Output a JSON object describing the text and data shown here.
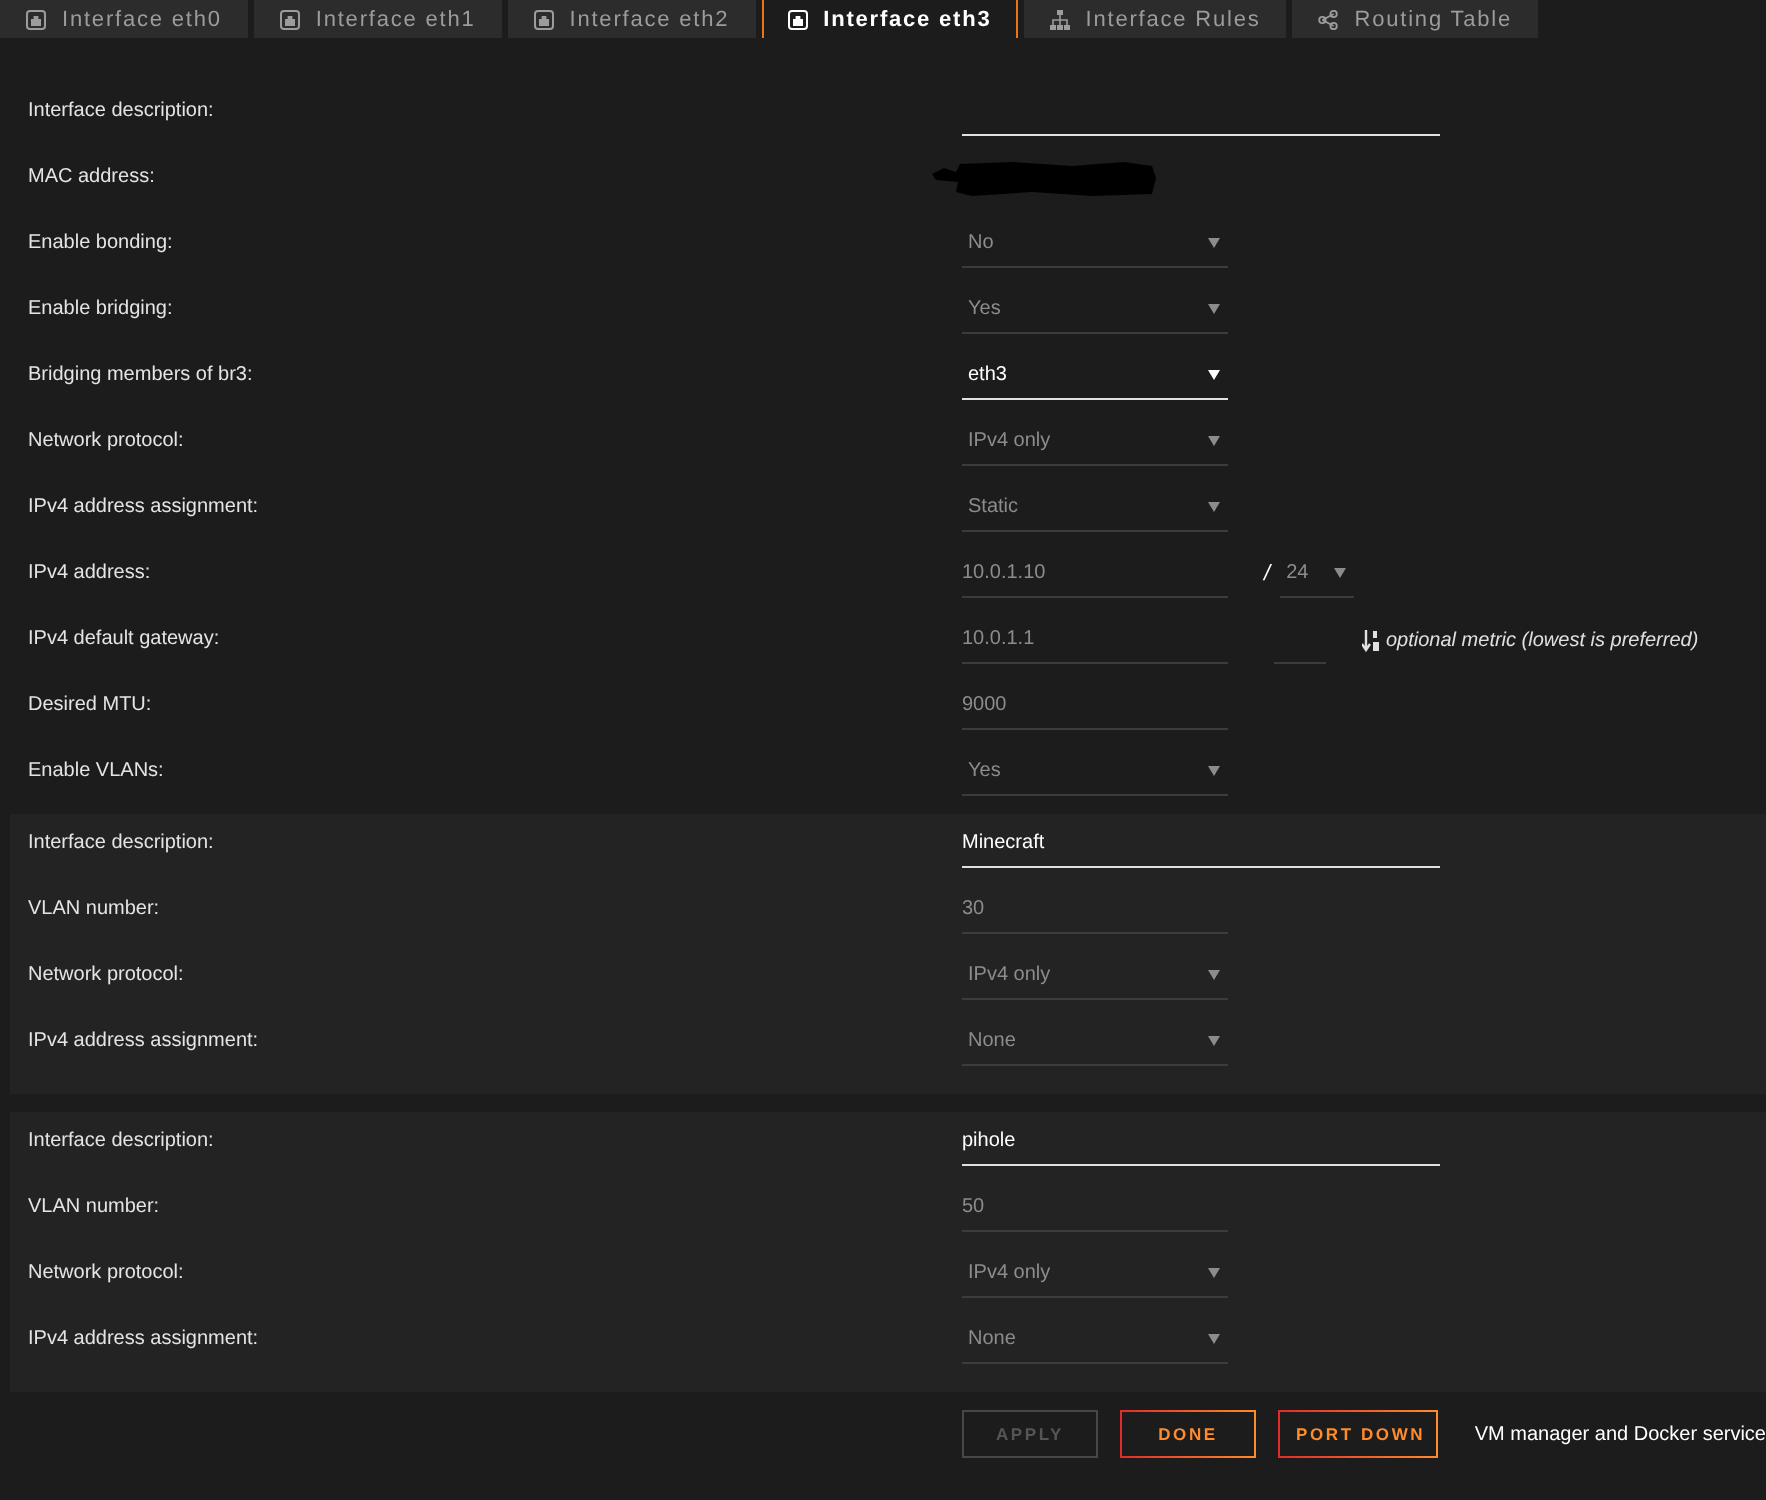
{
  "tabs": [
    {
      "label": "Interface eth0",
      "kind": "interface",
      "selected": false
    },
    {
      "label": "Interface eth1",
      "kind": "interface",
      "selected": false
    },
    {
      "label": "Interface eth2",
      "kind": "interface",
      "selected": false
    },
    {
      "label": "Interface eth3",
      "kind": "interface",
      "selected": true
    },
    {
      "label": "Interface Rules",
      "kind": "rules",
      "selected": false
    },
    {
      "label": "Routing Table",
      "kind": "routing",
      "selected": false
    }
  ],
  "interface": {
    "rows": [
      {
        "label": "Interface description:",
        "kind": "line",
        "disabled": false
      },
      {
        "label": "MAC address:",
        "kind": "redacted"
      },
      {
        "label": "Enable bonding:",
        "kind": "select",
        "value": "No",
        "disabled": true
      },
      {
        "label": "Enable bridging:",
        "kind": "select",
        "value": "Yes",
        "disabled": true
      },
      {
        "label": "Bridging members of br3:",
        "kind": "select",
        "value": "eth3",
        "disabled": false
      },
      {
        "label": "Network protocol:",
        "kind": "select",
        "value": "IPv4 only",
        "disabled": true
      },
      {
        "label": "IPv4 address assignment:",
        "kind": "select",
        "value": "Static",
        "disabled": true
      },
      {
        "label": "IPv4 address:",
        "kind": "address",
        "value": "10.0.1.10",
        "disabled": true,
        "separator": "/",
        "prefix": {
          "value": "24",
          "disabled": true
        }
      },
      {
        "label": "IPv4 default gateway:",
        "kind": "gateway",
        "value": "10.0.1.1",
        "disabled": true,
        "metric": {
          "disabled": true
        },
        "hint": "optional metric (lowest is preferred)"
      },
      {
        "label": "Desired MTU:",
        "kind": "number",
        "value": "9000",
        "disabled": true
      },
      {
        "label": "Enable VLANs:",
        "kind": "select",
        "value": "Yes",
        "disabled": true
      }
    ]
  },
  "vlans": [
    {
      "rows": [
        {
          "label": "Interface description:",
          "kind": "line",
          "value": "Minecraft",
          "disabled": false
        },
        {
          "label": "VLAN number:",
          "kind": "number",
          "value": "30",
          "disabled": true
        },
        {
          "label": "Network protocol:",
          "kind": "select",
          "value": "IPv4 only",
          "disabled": true
        },
        {
          "label": "IPv4 address assignment:",
          "kind": "select",
          "value": "None",
          "disabled": true
        }
      ]
    },
    {
      "rows": [
        {
          "label": "Interface description:",
          "kind": "line",
          "value": "pihole",
          "disabled": false
        },
        {
          "label": "VLAN number:",
          "kind": "number",
          "value": "50",
          "disabled": true
        },
        {
          "label": "Network protocol:",
          "kind": "select",
          "value": "IPv4 only",
          "disabled": true
        },
        {
          "label": "IPv4 address assignment:",
          "kind": "select",
          "value": "None",
          "disabled": true
        }
      ]
    }
  ],
  "buttons": [
    {
      "label": "APPLY",
      "disabled": true
    },
    {
      "label": "DONE",
      "disabled": false
    },
    {
      "label": "PORT DOWN",
      "disabled": false
    }
  ],
  "note": "VM manager and Docker service"
}
